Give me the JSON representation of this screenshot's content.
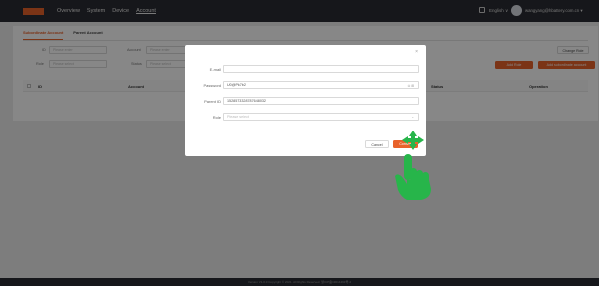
{
  "nav": {
    "logo": "",
    "items": [
      "Overview",
      "System",
      "Device",
      "Account"
    ]
  },
  "topbar": {
    "language": "English ∨",
    "user_email": "wangyang@hbattery.com.cn ▾"
  },
  "tabs": [
    "Subordinate Account",
    "Parent Account"
  ],
  "filters": {
    "id_label": "ID",
    "id_placeholder": "Please enter",
    "account_label": "Account",
    "account_placeholder": "Please enter",
    "role_label": "Role",
    "role_placeholder": "Please select",
    "status_label": "Status",
    "status_placeholder": "Please select"
  },
  "buttons": {
    "change_role": "Change Role",
    "add_role": "Add Role",
    "add_sub_account": "Add subordinate account"
  },
  "table": {
    "headers": [
      "ID",
      "Account",
      "Status",
      "Operation"
    ]
  },
  "footer": {
    "text": "Version V1.0.0  Copyright © 2021. All Rights Reserved.  浙ICP备19014493号-2"
  },
  "modal": {
    "close": "×",
    "email_label": "E-mail",
    "email_value": "",
    "password_label": "Password",
    "password_value": "U0@Pk7b2",
    "password_icons": "⊙ ⊞",
    "parent_id_label": "Parent ID",
    "parent_id_value": "1528573328787648032",
    "role_label": "Role",
    "role_placeholder": "Please select",
    "caret": "⌄",
    "cancel": "Cancel",
    "confirm": "Confirm"
  },
  "colors": {
    "accent": "#e8622a",
    "topbar": "#2b2d33",
    "hint_green": "#27b54a"
  }
}
